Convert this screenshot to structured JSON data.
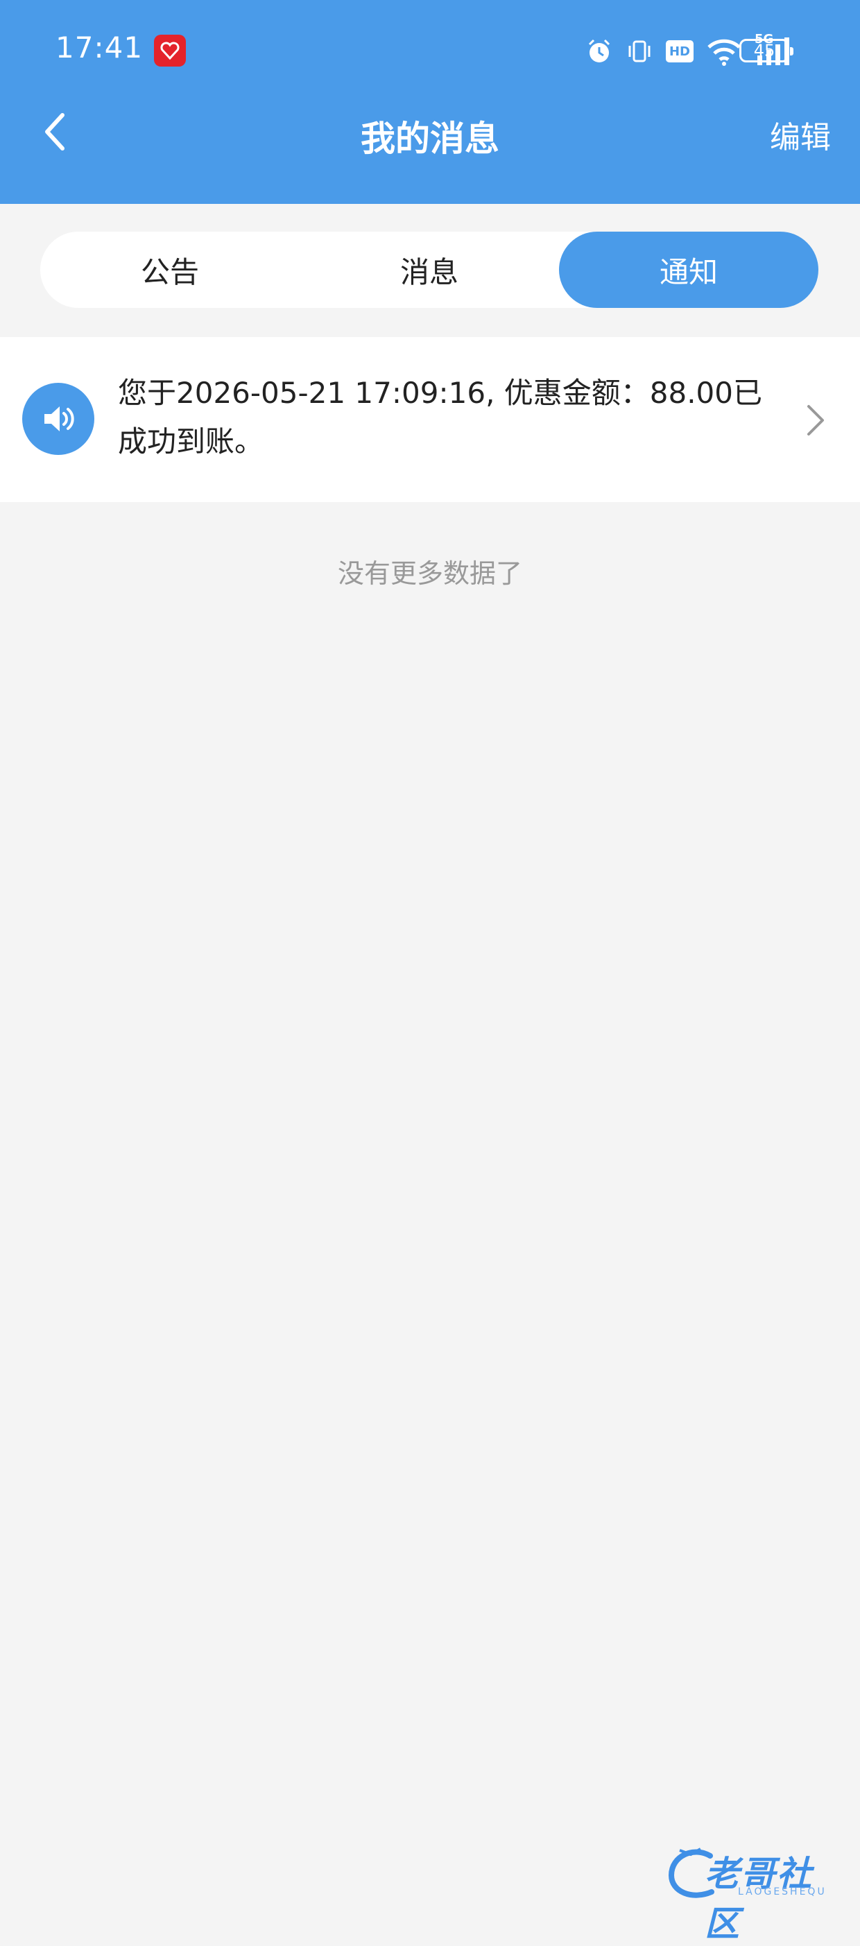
{
  "status_bar": {
    "time": "17:41",
    "hd_label": "HD",
    "network_label": "5G",
    "battery_level": "45"
  },
  "header": {
    "title": "我的消息",
    "edit_label": "编辑"
  },
  "tabs": [
    {
      "label": "公告",
      "active": false
    },
    {
      "label": "消息",
      "active": false
    },
    {
      "label": "通知",
      "active": true
    }
  ],
  "notifications": [
    {
      "text": "您于2026-05-21 17:09:16, 优惠金额：88.00已成功到账。"
    }
  ],
  "list_footer": "没有更多数据了",
  "watermark": {
    "text": "老哥社区",
    "subtext": "LAOGESHEQU"
  },
  "colors": {
    "accent": "#4a9be9",
    "background": "#f4f4f4"
  }
}
